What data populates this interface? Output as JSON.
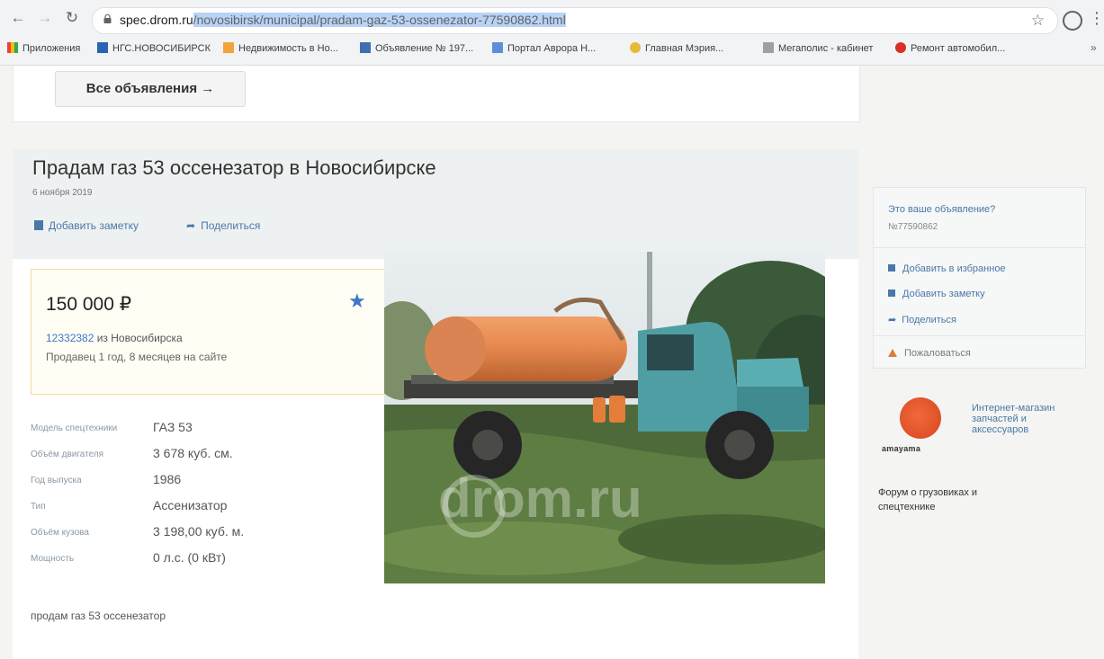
{
  "browser": {
    "url_host": "spec.drom.ru",
    "url_path": "/novosibirsk/municipal/pradam-gaz-53-ossenezator-77590862.html",
    "bookmarks": [
      "Приложения",
      "НГС.НОВОСИБИРСК",
      "Недвижимость в Но...",
      "Объявление № 197...",
      "Портал Аврора Н...",
      "Главная Мэрия...",
      "Мегаполис - кабинет",
      "Ремонт автомобил..."
    ]
  },
  "top": {
    "all_ads_label": "Все объявления →"
  },
  "listing": {
    "title": "Прадам газ 53 оссенезатор в Новосибирске",
    "date": "6 ноября 2019",
    "add_note": "Добавить заметку",
    "share": "Поделиться",
    "price": "150 000 ₽",
    "seller_id": "12332382",
    "seller_city": " из Новосибирска",
    "seller_since": "Продавец 1 год, 8 месяцев на сайте",
    "specs": [
      {
        "label": "Модель спецтехники",
        "value": "ГАЗ 53"
      },
      {
        "label": "Объём двигателя",
        "value": "3 678 куб. см."
      },
      {
        "label": "Год выпуска",
        "value": "1986"
      },
      {
        "label": "Тип",
        "value": "Ассенизатор"
      },
      {
        "label": "Объём кузова",
        "value": "3 198,00 куб. м."
      },
      {
        "label": "Мощность",
        "value": "0 л.с. (0 кВт)"
      }
    ],
    "description": "продам газ 53 оссенезатор",
    "watermark": "drom.ru"
  },
  "sidebar": {
    "question": "Это ваше объявление?",
    "ad_number": "№77590862",
    "add_favorite": "Добавить в избранное",
    "add_note": "Добавить заметку",
    "share": "Поделиться",
    "complain": "Пожаловаться",
    "shop_name": "Интернет-магазин запчастей и аксессуаров",
    "shop_logo_caption": "amayama",
    "shop_footer": "Форум о грузовиках и спецтехнике"
  },
  "colors": {
    "accent_link": "#4a78a8",
    "favorite_star": "#3d77c9",
    "price_border": "#f3dc9c"
  }
}
